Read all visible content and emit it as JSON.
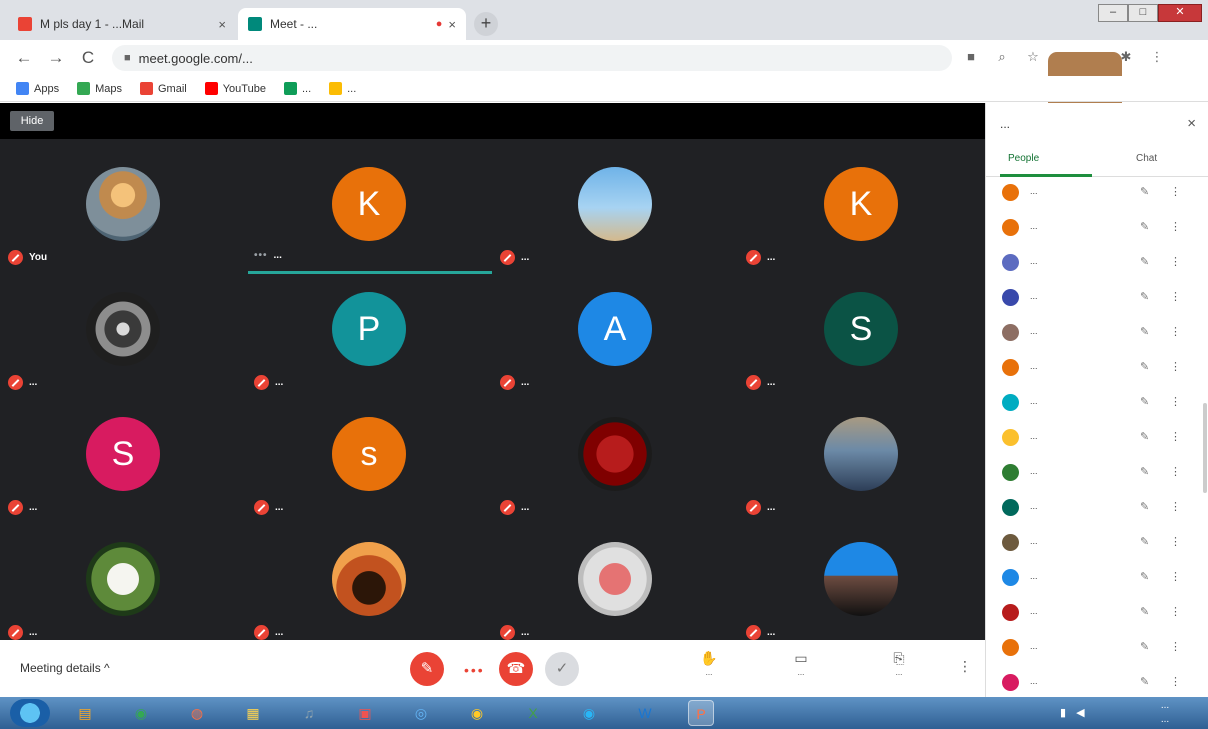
{
  "browser": {
    "tabs": [
      {
        "title": "M pls day 1 - ...Mail",
        "active": false,
        "favicon_color": "#ea4335"
      },
      {
        "title": "Meet - ...",
        "active": true,
        "favicon_color": "#00897b"
      }
    ],
    "new_tab_label": "+",
    "close_glyph": "×",
    "rec_glyph": "●",
    "url": "meet.google.com/...",
    "window_controls": {
      "minimize": "–",
      "maximize": "□",
      "close": "✕"
    },
    "nav": {
      "back": "←",
      "forward": "→",
      "reload": "C"
    },
    "bookmarks": [
      {
        "label": "Apps",
        "icon_color": "#4285f4"
      },
      {
        "label": "Maps",
        "icon_color": "#34a853"
      },
      {
        "label": "Gmail",
        "icon_color": "#ea4335"
      },
      {
        "label": "YouTube",
        "icon_color": "#ff0000"
      },
      {
        "label": "...",
        "icon_color": "#0f9d58"
      },
      {
        "label": "...",
        "icon_color": "#fbbc04"
      }
    ]
  },
  "meet": {
    "hide_label": "Hide",
    "tiles": [
      {
        "name": "You",
        "initial": "",
        "color": "",
        "photo": "ph-tea"
      },
      {
        "name": "...",
        "initial": "K",
        "color": "#e8710a",
        "photo": "",
        "speaking": true
      },
      {
        "name": "...",
        "initial": "",
        "color": "",
        "photo": "ph-sky"
      },
      {
        "name": "...",
        "initial": "K",
        "color": "#e8710a",
        "photo": ""
      },
      {
        "name": "...",
        "initial": "",
        "color": "",
        "photo": "ph-bw"
      },
      {
        "name": "...",
        "initial": "P",
        "color": "#12939a",
        "photo": ""
      },
      {
        "name": "...",
        "initial": "A",
        "color": "#1e88e5",
        "photo": ""
      },
      {
        "name": "...",
        "initial": "S",
        "color": "#0b5345",
        "photo": ""
      },
      {
        "name": "...",
        "initial": "S",
        "color": "#d81b60",
        "photo": ""
      },
      {
        "name": "...",
        "initial": "s",
        "color": "#e8710a",
        "photo": ""
      },
      {
        "name": "...",
        "initial": "",
        "color": "",
        "photo": "ph-rose"
      },
      {
        "name": "...",
        "initial": "",
        "color": "",
        "photo": "ph-man"
      },
      {
        "name": "...",
        "initial": "",
        "color": "",
        "photo": "ph-flower"
      },
      {
        "name": "...",
        "initial": "",
        "color": "",
        "photo": "ph-sun"
      },
      {
        "name": "...",
        "initial": "",
        "color": "",
        "photo": "ph-fruit"
      },
      {
        "name": "...",
        "initial": "",
        "color": "",
        "photo": "ph-suit"
      }
    ],
    "bottom": {
      "meeting_details": "Meeting details ^",
      "controls_dots": "•••",
      "buttons": [
        {
          "icon": "✋",
          "label": "..."
        },
        {
          "icon": "▭",
          "label": "..."
        },
        {
          "icon": "⎘",
          "label": "..."
        }
      ],
      "more": "⋮"
    }
  },
  "panel": {
    "title": "...",
    "close": "×",
    "people_tab": "People",
    "chat_tab": "Chat",
    "participants": [
      {
        "name": "...",
        "color": "#e8710a"
      },
      {
        "name": "...",
        "color": "#e8710a"
      },
      {
        "name": "...",
        "color": "#5c6bc0"
      },
      {
        "name": "...",
        "color": "#3949ab"
      },
      {
        "name": "...",
        "color": "#8d6e63"
      },
      {
        "name": "...",
        "color": "#e8710a"
      },
      {
        "name": "...",
        "color": "#00acc1"
      },
      {
        "name": "...",
        "color": "#fbc02d"
      },
      {
        "name": "...",
        "color": "#2e7d32"
      },
      {
        "name": "...",
        "color": "#00695c"
      },
      {
        "name": "...",
        "color": "#6d5a3e"
      },
      {
        "name": "...",
        "color": "#1e88e5"
      },
      {
        "name": "...",
        "color": "#b71c1c"
      },
      {
        "name": "...",
        "color": "#e8710a"
      },
      {
        "name": "...",
        "color": "#d81b60"
      }
    ],
    "mic_glyph": "✎",
    "more_glyph": "⋮"
  },
  "taskbar": {
    "apps": [
      {
        "icon": "▤",
        "color": "#f9a825"
      },
      {
        "icon": "◉",
        "color": "#34a853"
      },
      {
        "icon": "◍",
        "color": "#ff7043"
      },
      {
        "icon": "▦",
        "color": "#ffd54f"
      },
      {
        "icon": "♫",
        "color": "#90a4ae"
      },
      {
        "icon": "▣",
        "color": "#ef5350"
      },
      {
        "icon": "◎",
        "color": "#64b5f6"
      },
      {
        "icon": "◉",
        "color": "#ffca28"
      },
      {
        "icon": "X",
        "color": "#43a047"
      },
      {
        "icon": "◉",
        "color": "#29b6f6"
      },
      {
        "icon": "W",
        "color": "#1976d2"
      },
      {
        "icon": "P",
        "color": "#ff7043"
      }
    ],
    "time": "...",
    "date": "..."
  }
}
